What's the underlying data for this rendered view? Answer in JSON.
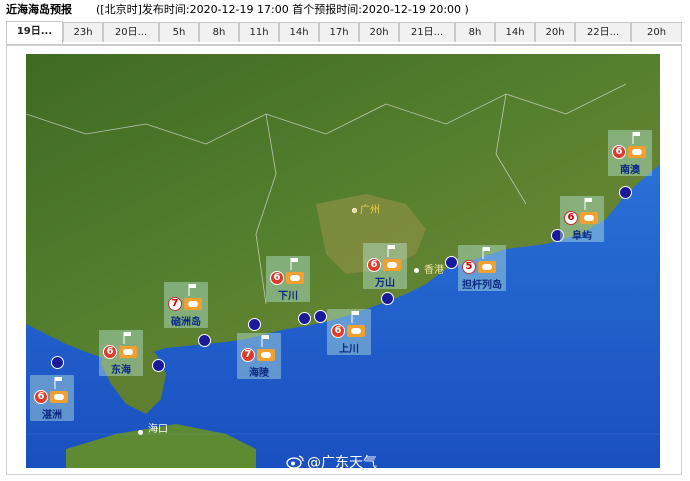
{
  "header": {
    "title": "近海海岛预报",
    "publish_info": "([北京时]发布时间:2020-12-19 17:00  首个预报时间:2020-12-19 20:00 )"
  },
  "tabs": [
    "19日...",
    "23h",
    "20日...",
    "5h",
    "8h",
    "11h",
    "14h",
    "17h",
    "20h",
    "21日...",
    "8h",
    "14h",
    "20h",
    "22日...",
    "20h"
  ],
  "active_tab": 0,
  "map": {
    "city_labels": {
      "guangzhou": "广州",
      "haikou": "海口",
      "hongkong": "香港"
    },
    "stations": [
      {
        "name": "湛洲",
        "level": "6"
      },
      {
        "name": "东海",
        "level": "6"
      },
      {
        "name": "硇洲岛",
        "level": "7"
      },
      {
        "name": "海陵",
        "level": "7"
      },
      {
        "name": "下川",
        "level": "6"
      },
      {
        "name": "上川",
        "level": "6"
      },
      {
        "name": "万山",
        "level": "6"
      },
      {
        "name": "担杆列岛",
        "level": "5"
      },
      {
        "name": "阜屿",
        "level": "6"
      },
      {
        "name": "南澳",
        "level": "6"
      }
    ],
    "colors": {
      "sea": "#1f5fd0",
      "land": "#4f7a2a",
      "marker": "#1a1a9a"
    }
  },
  "watermark": "@广东天气"
}
